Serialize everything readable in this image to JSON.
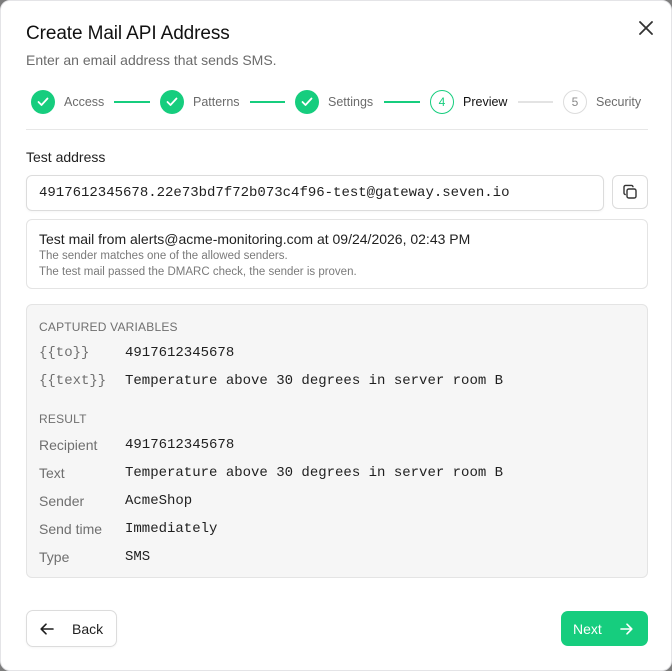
{
  "dialog": {
    "title": "Create Mail API Address",
    "subtitle": "Enter an email address that sends SMS."
  },
  "steps": [
    {
      "number": "1",
      "label": "Access",
      "state": "done"
    },
    {
      "number": "2",
      "label": "Patterns",
      "state": "done"
    },
    {
      "number": "3",
      "label": "Settings",
      "state": "done"
    },
    {
      "number": "4",
      "label": "Preview",
      "state": "active"
    },
    {
      "number": "5",
      "label": "Security",
      "state": "todo"
    }
  ],
  "test_address": {
    "label": "Test address",
    "value": "4917612345678.22e73bd7f72b073c4f96-test@gateway.seven.io"
  },
  "mail_check": {
    "headline": "Test mail from alerts@acme-monitoring.com at 09/24/2026, 02:43 PM",
    "note_sender": "The sender matches one of the allowed senders.",
    "note_dmarc": "The test mail passed the DMARC check, the sender is proven."
  },
  "captured": {
    "title": "CAPTURED VARIABLES",
    "rows": [
      {
        "key": "{{to}}",
        "value": "4917612345678"
      },
      {
        "key": "{{text}}",
        "value": "Temperature above 30 degrees in server room B"
      }
    ]
  },
  "result": {
    "title": "RESULT",
    "rows": [
      {
        "key": "Recipient",
        "value": "4917612345678"
      },
      {
        "key": "Text",
        "value": "Temperature above 30 degrees in server room B"
      },
      {
        "key": "Sender",
        "value": "AcmeShop"
      },
      {
        "key": "Send time",
        "value": "Immediately"
      },
      {
        "key": "Type",
        "value": "SMS"
      }
    ]
  },
  "footer": {
    "back_label": "Back",
    "next_label": "Next"
  },
  "colors": {
    "accent": "#16cd7e",
    "overlay": "#7c7c7c"
  },
  "icons": {
    "close": "close-icon",
    "copy": "copy-icon",
    "check": "check-icon",
    "back": "arrow-left-icon",
    "next": "arrow-right-icon"
  }
}
